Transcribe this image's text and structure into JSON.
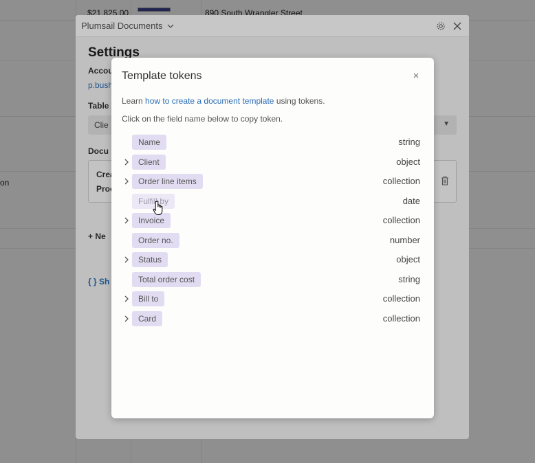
{
  "background": {
    "price_cell": "$21,825.00",
    "address_cell": "890 South Wrangler Street",
    "side_fragment": "on"
  },
  "plumsail": {
    "title": "Plumsail Documents",
    "settings_heading": "Settings",
    "account_label": "Accou",
    "account_link": "p.bush",
    "table_label": "Table",
    "table_value": "Clie",
    "documents_label": "Docu",
    "doc_line1": "Crea",
    "doc_line2": "Proc",
    "new_label": "+ Ne",
    "show_label": "Sh"
  },
  "modal": {
    "title": "Template tokens",
    "hint_prefix": "Learn ",
    "hint_link": "how to create a document template",
    "hint_suffix": " using tokens.",
    "hint_copy": "Click on the field name below to copy token.",
    "tokens": [
      {
        "name": "Name",
        "type": "string",
        "expandable": false
      },
      {
        "name": "Client",
        "type": "object",
        "expandable": true
      },
      {
        "name": "Order line items",
        "type": "collection",
        "expandable": true
      },
      {
        "name": "Fulfill by",
        "type": "date",
        "expandable": false,
        "hovered": true
      },
      {
        "name": "Invoice",
        "type": "collection",
        "expandable": true
      },
      {
        "name": "Order no.",
        "type": "number",
        "expandable": false
      },
      {
        "name": "Status",
        "type": "object",
        "expandable": true
      },
      {
        "name": "Total order cost",
        "type": "string",
        "expandable": false
      },
      {
        "name": "Bill to",
        "type": "collection",
        "expandable": true
      },
      {
        "name": "Card",
        "type": "collection",
        "expandable": true
      }
    ]
  },
  "colors": {
    "token_bg": "#e2dcf2",
    "link": "#2a6db5"
  },
  "icons": {
    "panel_header": [
      "chevron-down-icon",
      "gear-icon",
      "close-icon"
    ],
    "modal": [
      "close-icon",
      "chevron-right-icon",
      "hand-pointer-icon",
      "trash-icon",
      "braces-icon"
    ]
  }
}
